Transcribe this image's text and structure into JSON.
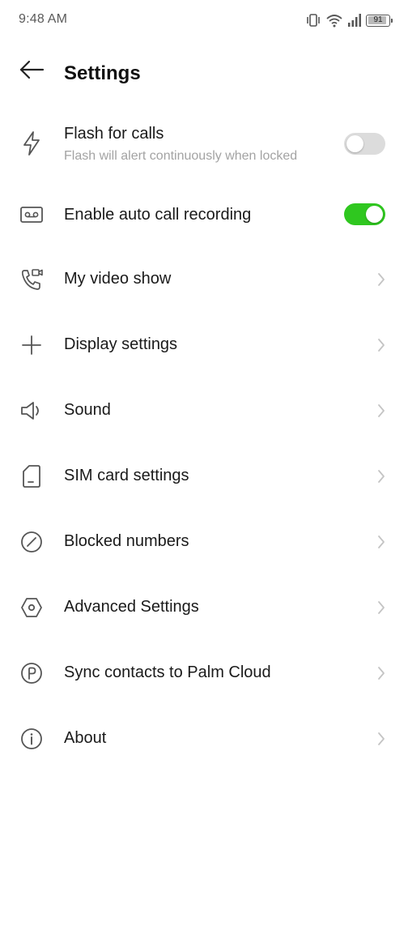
{
  "status_bar": {
    "time": "9:48 AM",
    "battery_level": 91,
    "icons": [
      "vibrate-icon",
      "wifi-icon",
      "signal-icon",
      "battery-icon"
    ]
  },
  "header": {
    "title": "Settings"
  },
  "settings": {
    "flash_for_calls": {
      "label": "Flash for calls",
      "sublabel": "Flash will alert continuously when locked",
      "enabled": false,
      "icon": "flash-icon"
    },
    "auto_call_recording": {
      "label": "Enable auto call recording",
      "enabled": true,
      "icon": "voicemail-icon"
    },
    "items": [
      {
        "label": "My video show",
        "icon": "video-call-icon"
      },
      {
        "label": "Display settings",
        "icon": "plus-icon"
      },
      {
        "label": "Sound",
        "icon": "speaker-icon"
      },
      {
        "label": "SIM card settings",
        "icon": "sim-card-icon"
      },
      {
        "label": "Blocked numbers",
        "icon": "block-icon"
      },
      {
        "label": "Advanced Settings",
        "icon": "hexagon-icon"
      },
      {
        "label": "Sync contacts to Palm Cloud",
        "icon": "palm-cloud-icon"
      },
      {
        "label": "About",
        "icon": "info-icon"
      }
    ]
  },
  "colors": {
    "toggle_on": "#2fc71f",
    "toggle_off": "#dcdcdc",
    "sublabel": "#a3a3a3",
    "icon": "#555555",
    "chevron": "#c4c4c4"
  }
}
